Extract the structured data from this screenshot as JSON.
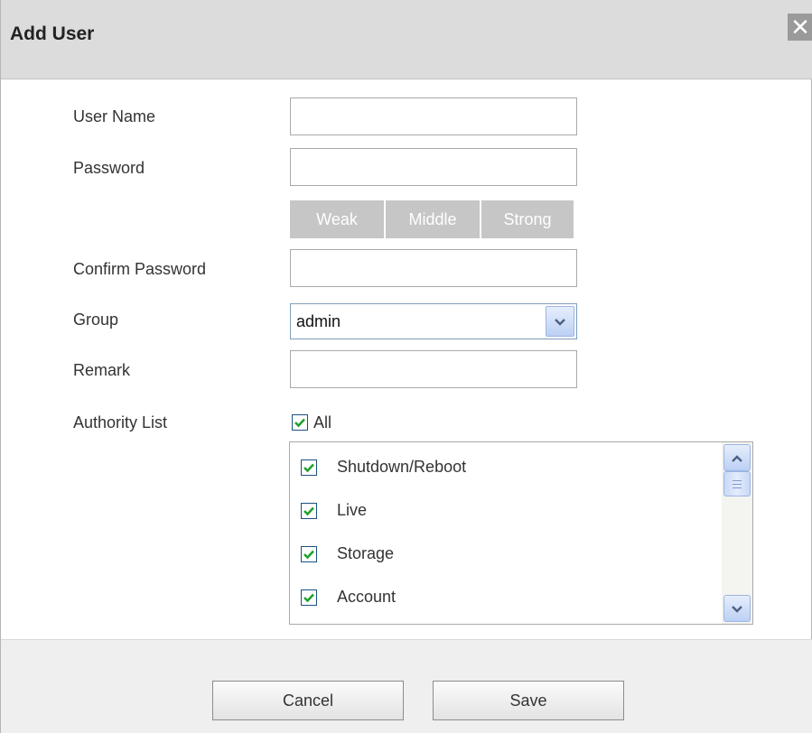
{
  "dialog": {
    "title": "Add User",
    "close_glyph": "✕"
  },
  "form": {
    "username_label": "User Name",
    "username_value": "",
    "password_label": "Password",
    "password_value": "",
    "strength": [
      "Weak",
      "Middle",
      "Strong"
    ],
    "confirm_label": "Confirm Password",
    "confirm_value": "",
    "group_label": "Group",
    "group_value": "admin",
    "remark_label": "Remark",
    "remark_value": "",
    "authority_label": "Authority List",
    "all_label": "All",
    "all_checked": true
  },
  "permissions": [
    {
      "label": "Shutdown/Reboot",
      "checked": true
    },
    {
      "label": "Live",
      "checked": true
    },
    {
      "label": "Storage",
      "checked": true
    },
    {
      "label": "Account",
      "checked": true
    }
  ],
  "footer": {
    "cancel_label": "Cancel",
    "save_label": "Save"
  },
  "colors": {
    "title_bar": "#dcdcdc",
    "strength_inactive": "#c6c6c6",
    "checkmark": "#22a12e"
  },
  "icons": {
    "close": "close-icon",
    "dropdown": "chevron-down-icon",
    "check": "checkmark-icon",
    "scroll_up": "chevron-up-icon",
    "scroll_down": "chevron-down-icon"
  }
}
